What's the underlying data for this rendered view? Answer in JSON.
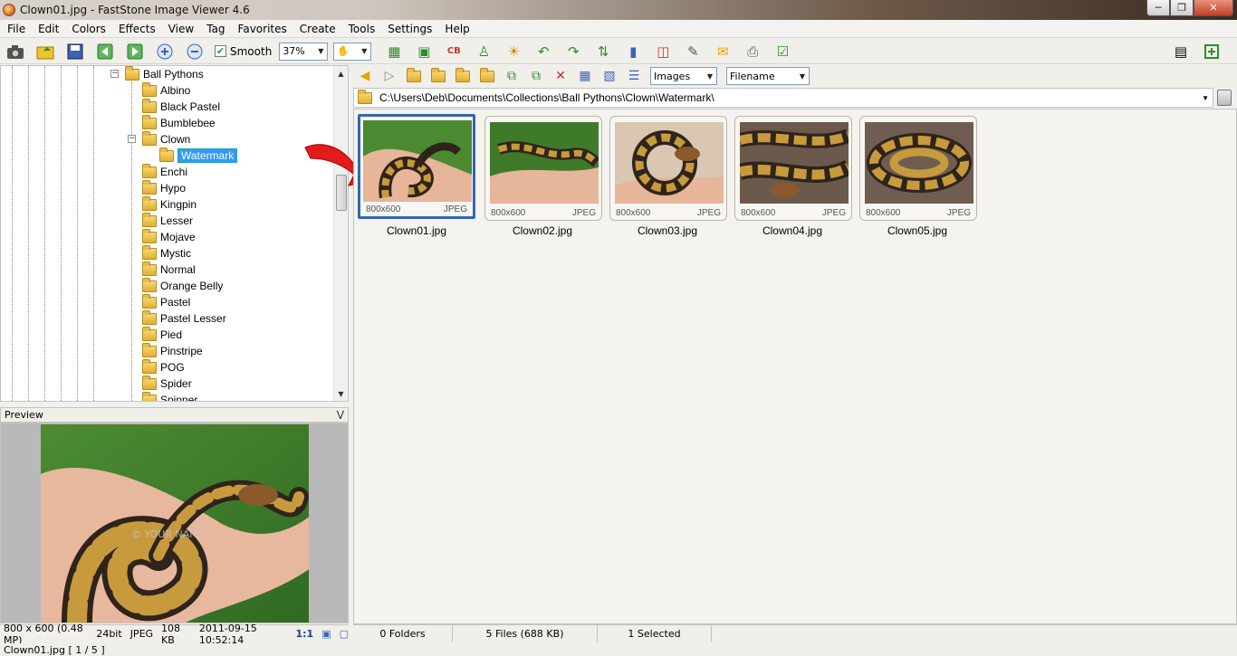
{
  "window": {
    "title": "Clown01.jpg  -  FastStone Image Viewer 4.6"
  },
  "menu": [
    "File",
    "Edit",
    "Colors",
    "Effects",
    "View",
    "Tag",
    "Favorites",
    "Create",
    "Tools",
    "Settings",
    "Help"
  ],
  "toolbar": {
    "smooth_label": "Smooth",
    "zoom_value": "37%"
  },
  "tree": {
    "parent": "Ball Pythons",
    "items": [
      "Albino",
      "Black Pastel",
      "Bumblebee",
      "Clown",
      "Watermark",
      "Enchi",
      "Hypo",
      "Kingpin",
      "Lesser",
      "Mojave",
      "Mystic",
      "Normal",
      "Orange Belly",
      "Pastel",
      "Pastel Lesser",
      "Pied",
      "Pinstripe",
      "POG",
      "Spider",
      "Spinner"
    ]
  },
  "preview": {
    "label": "Preview",
    "watermark": "© YOUR NAME"
  },
  "browser": {
    "filter": "Images",
    "sort": "Filename",
    "path": "C:\\Users\\Deb\\Documents\\Collections\\Ball Pythons\\Clown\\Watermark\\",
    "thumbnails": [
      {
        "name": "Clown01.jpg",
        "dims": "800x600",
        "format": "JPEG"
      },
      {
        "name": "Clown02.jpg",
        "dims": "800x600",
        "format": "JPEG"
      },
      {
        "name": "Clown03.jpg",
        "dims": "800x600",
        "format": "JPEG"
      },
      {
        "name": "Clown04.jpg",
        "dims": "800x600",
        "format": "JPEG"
      },
      {
        "name": "Clown05.jpg",
        "dims": "800x600",
        "format": "JPEG"
      }
    ]
  },
  "status_left": {
    "dims": "800 x 600 (0.48 MP)",
    "depth": "24bit",
    "format": "JPEG",
    "size": "108 KB",
    "date": "2011-09-15 10:52:14",
    "ratio": "1:1"
  },
  "status_right": {
    "folders": "0 Folders",
    "files": "5 Files (688 KB)",
    "selected": "1 Selected"
  },
  "bottom": {
    "current": "Clown01.jpg [ 1 / 5 ]"
  }
}
